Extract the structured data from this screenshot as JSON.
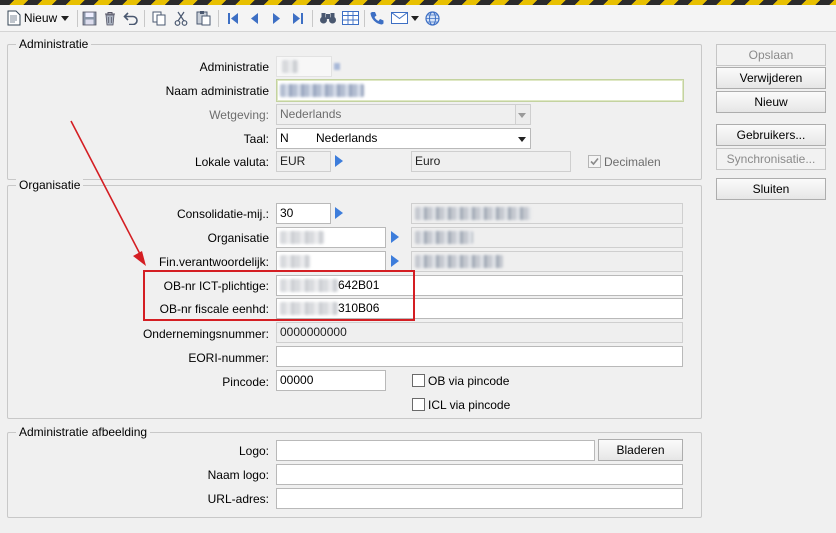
{
  "toolbar": {
    "new_label": "Nieuw",
    "icons": [
      "new-document-icon",
      "save-icon",
      "delete-icon",
      "undo-icon",
      "copy-icon",
      "cut-icon",
      "paste-icon",
      "first-record-icon",
      "previous-record-icon",
      "next-record-icon",
      "last-record-icon",
      "binoculars-search-icon",
      "grid-view-icon",
      "phone-icon",
      "email-icon",
      "globe-icon"
    ]
  },
  "administratie": {
    "legend": "Administratie",
    "administratie_label": "Administratie",
    "naam_label": "Naam administratie",
    "wetgeving_label": "Wetgeving:",
    "wetgeving_value": "Nederlands",
    "taal_label": "Taal:",
    "taal_code": "N",
    "taal_value": "Nederlands",
    "valuta_label": "Lokale valuta:",
    "valuta_code": "EUR",
    "valuta_name": "Euro",
    "decimalen_label": "Decimalen",
    "decimalen_checked": true
  },
  "organisatie": {
    "legend": "Organisatie",
    "consolidatie_label": "Consolidatie-mij.:",
    "consolidatie_value": "30",
    "organisatie_label": "Organisatie",
    "fin_label": "Fin.verantwoordelijk:",
    "obnr_ict_label": "OB-nr ICT-plichtige:",
    "obnr_ict_value": "642B01",
    "obnr_fiscale_label": "OB-nr fiscale eenhd:",
    "obnr_fiscale_value": "310B06",
    "ondernemingsnummer_label": "Ondernemingsnummer:",
    "ondernemingsnummer_value": "0000000000",
    "eori_label": "EORI-nummer:",
    "eori_value": "",
    "pincode_label": "Pincode:",
    "pincode_value": "00000",
    "ob_via_pincode_label": "OB via pincode",
    "icl_via_pincode_label": "ICL via pincode"
  },
  "afbeelding": {
    "legend": "Administratie afbeelding",
    "logo_label": "Logo:",
    "logo_value": "",
    "bladeren_label": "Bladeren",
    "naam_logo_label": "Naam logo:",
    "naam_logo_value": "",
    "url_label": "URL-adres:",
    "url_value": ""
  },
  "buttons": {
    "opslaan": "Opslaan",
    "verwijderen": "Verwijderen",
    "nieuw": "Nieuw",
    "gebruikers": "Gebruikers...",
    "synchronisatie": "Synchronisatie...",
    "sluiten": "Sluiten"
  },
  "colors": {
    "accent_arrow": "#3d7ddb",
    "highlight": "#d41e23"
  }
}
